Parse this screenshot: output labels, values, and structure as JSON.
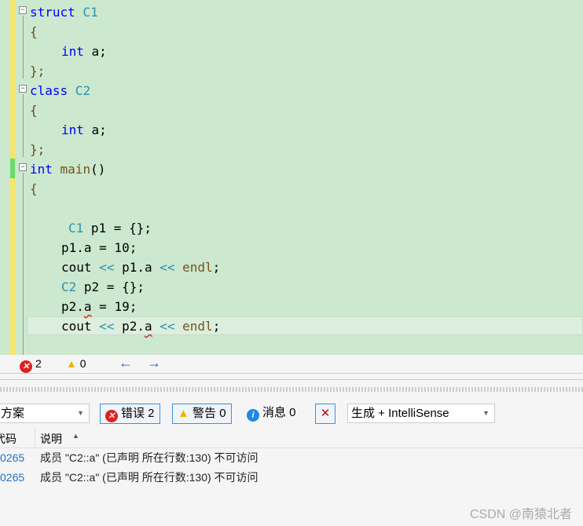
{
  "editor": {
    "lines": {
      "l0": [
        "struct",
        " C1"
      ],
      "l1": "{",
      "l2": [
        "int",
        " a;"
      ],
      "l3": "};",
      "l4": [
        "class",
        " C2"
      ],
      "l5": "{",
      "l6": [
        "int",
        " a;"
      ],
      "l7": "};",
      "l8": [
        "int",
        " main",
        "()"
      ],
      "l9": "{",
      "l11": [
        "C1",
        " p1 = {};"
      ],
      "l12": "p1.a = 10;",
      "l13": [
        "cout ",
        "<<",
        " p1.a ",
        "<<",
        " endl",
        ";"
      ],
      "l14": [
        "C2",
        " p2 = {};"
      ],
      "l15": [
        "p2.",
        "a",
        " = 19;"
      ],
      "l16": [
        "cout ",
        "<<",
        " p2.",
        "a",
        " ",
        "<<",
        " endl",
        ";"
      ]
    }
  },
  "status": {
    "errors": "2",
    "warnings": "0"
  },
  "toolbar": {
    "scope": "方案",
    "errors": "错误 2",
    "warnings": "警告 0",
    "messages": "消息 0",
    "source": "生成 + IntelliSense"
  },
  "table": {
    "headers": [
      "代码",
      "说明"
    ],
    "rows": [
      {
        "code": "0265",
        "desc": "成员 \"C2::a\" (已声明 所在行数:130) 不可访问"
      },
      {
        "code": "0265",
        "desc": "成员 \"C2::a\" (已声明 所在行数:130) 不可访问"
      }
    ]
  },
  "watermark": "CSDN @南猿北者",
  "colors": {
    "editor_bg": "#cce8cf",
    "keyword": "#0000ff",
    "type": "#2b91af",
    "accent": "#3e8ee0"
  }
}
